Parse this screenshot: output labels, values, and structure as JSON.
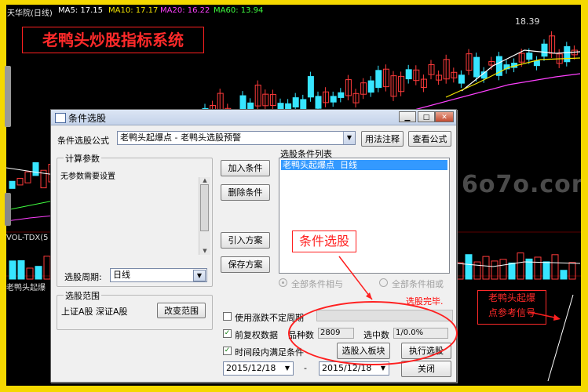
{
  "header": {
    "stock": "天华院(日线)",
    "ma5": "MA5: 17.15",
    "ma10": "MA10: 17.17",
    "ma20": "MA20: 16.22",
    "ma60": "MA60: 13.94"
  },
  "chart_title": "老鸭头炒股指标系统",
  "peak_label": "18.39",
  "vol_label": "VOL-TDX(5",
  "indicator_label": "老鸭头起爆",
  "watermark": "6o7o.com",
  "signal_box": {
    "line1": "老鸭头起爆",
    "line2": "点参考信号"
  },
  "callout": "条件选股",
  "dialog": {
    "title": "条件选股",
    "formula_label": "条件选股公式",
    "formula_value": "老鸭头起爆点 - 老鸭头选股预警",
    "usage_button": "用法注释",
    "view_formula_button": "查看公式",
    "calc_params_title": "计算参数",
    "no_params": "无参数需要设置",
    "period_label": "选股周期:",
    "period_value": "日线",
    "add_condition": "加入条件",
    "delete_condition": "删除条件",
    "import_plan": "引入方案",
    "save_plan": "保存方案",
    "condition_list_title": "选股条件列表",
    "condition_item": "老鸭头起爆点  日线",
    "radio_and": "全部条件相与",
    "radio_or": "全部条件相或",
    "status": "选股完毕.",
    "range_title": "选股范围",
    "range_value": "上证A股 深证A股",
    "change_range": "改变范围",
    "use_period_label": "使用涨跌不定周期",
    "use_period_checked": false,
    "restored_label": "前复权数据",
    "restored_checked": true,
    "count_label": "品种数",
    "count_value": "2809",
    "selected_label": "选中数",
    "selected_value": "1/0.0%",
    "time_label": "时间段内满足条件",
    "time_checked": true,
    "add_to_block": "选股入板块",
    "execute": "执行选股",
    "date_from": "2015/12/18",
    "date_sep": "-",
    "date_to": "2015/12/18",
    "close": "关闭"
  }
}
